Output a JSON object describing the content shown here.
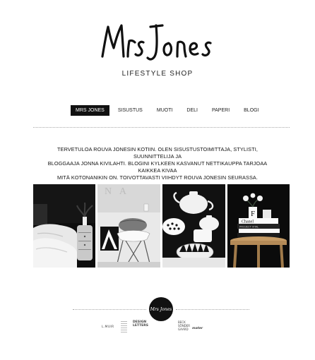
{
  "brand": {
    "logo_text": "Mrs Jones",
    "tagline": "LIFESTYLE SHOP"
  },
  "nav": {
    "items": [
      {
        "label": "MRS JONES",
        "active": true
      },
      {
        "label": "SISUSTUS",
        "active": false
      },
      {
        "label": "MUOTI",
        "active": false
      },
      {
        "label": "DELI",
        "active": false
      },
      {
        "label": "PAPERI",
        "active": false
      },
      {
        "label": "BLOGI",
        "active": false
      }
    ]
  },
  "intro": {
    "line1": "TERVETULOA ROUVA JONESIN KOTIIN. OLEN SISUSTUSTOIMITTAJA, STYLISTI, SUUNNITTELIJA JA",
    "line2": "BLOGGAAJA JONNA KIVILAHTI. BLOGINI KYLKEEN KASVANUT NETTIKAUPPA TARJOAA KAIKKEA KIVAA",
    "line3": "MITÄ KOTONANIKIN ON. TOIVOTTAVASTI VIIHDYT ROUVA JONESIN SEURASSA."
  },
  "gallery": {
    "photos": [
      {
        "alt": "bedroom-photo"
      },
      {
        "alt": "chair-photo"
      },
      {
        "alt": "teaware-photo"
      },
      {
        "alt": "stool-books-photo"
      }
    ],
    "text_in_images": {
      "letter_f": "F",
      "book_chanel": "Chanel",
      "book_project": "PROJECT VITAL"
    }
  },
  "footer": {
    "badge_text": "Mrs Jones",
    "partners": {
      "muir": "L.MUIR",
      "design_letters_1": "DESIGN",
      "design_letters_2": "LETTERS",
      "beck_1": "BECK",
      "beck_2": "SÖNDER",
      "beck_3": "GAARD",
      "mater": "mater"
    }
  }
}
